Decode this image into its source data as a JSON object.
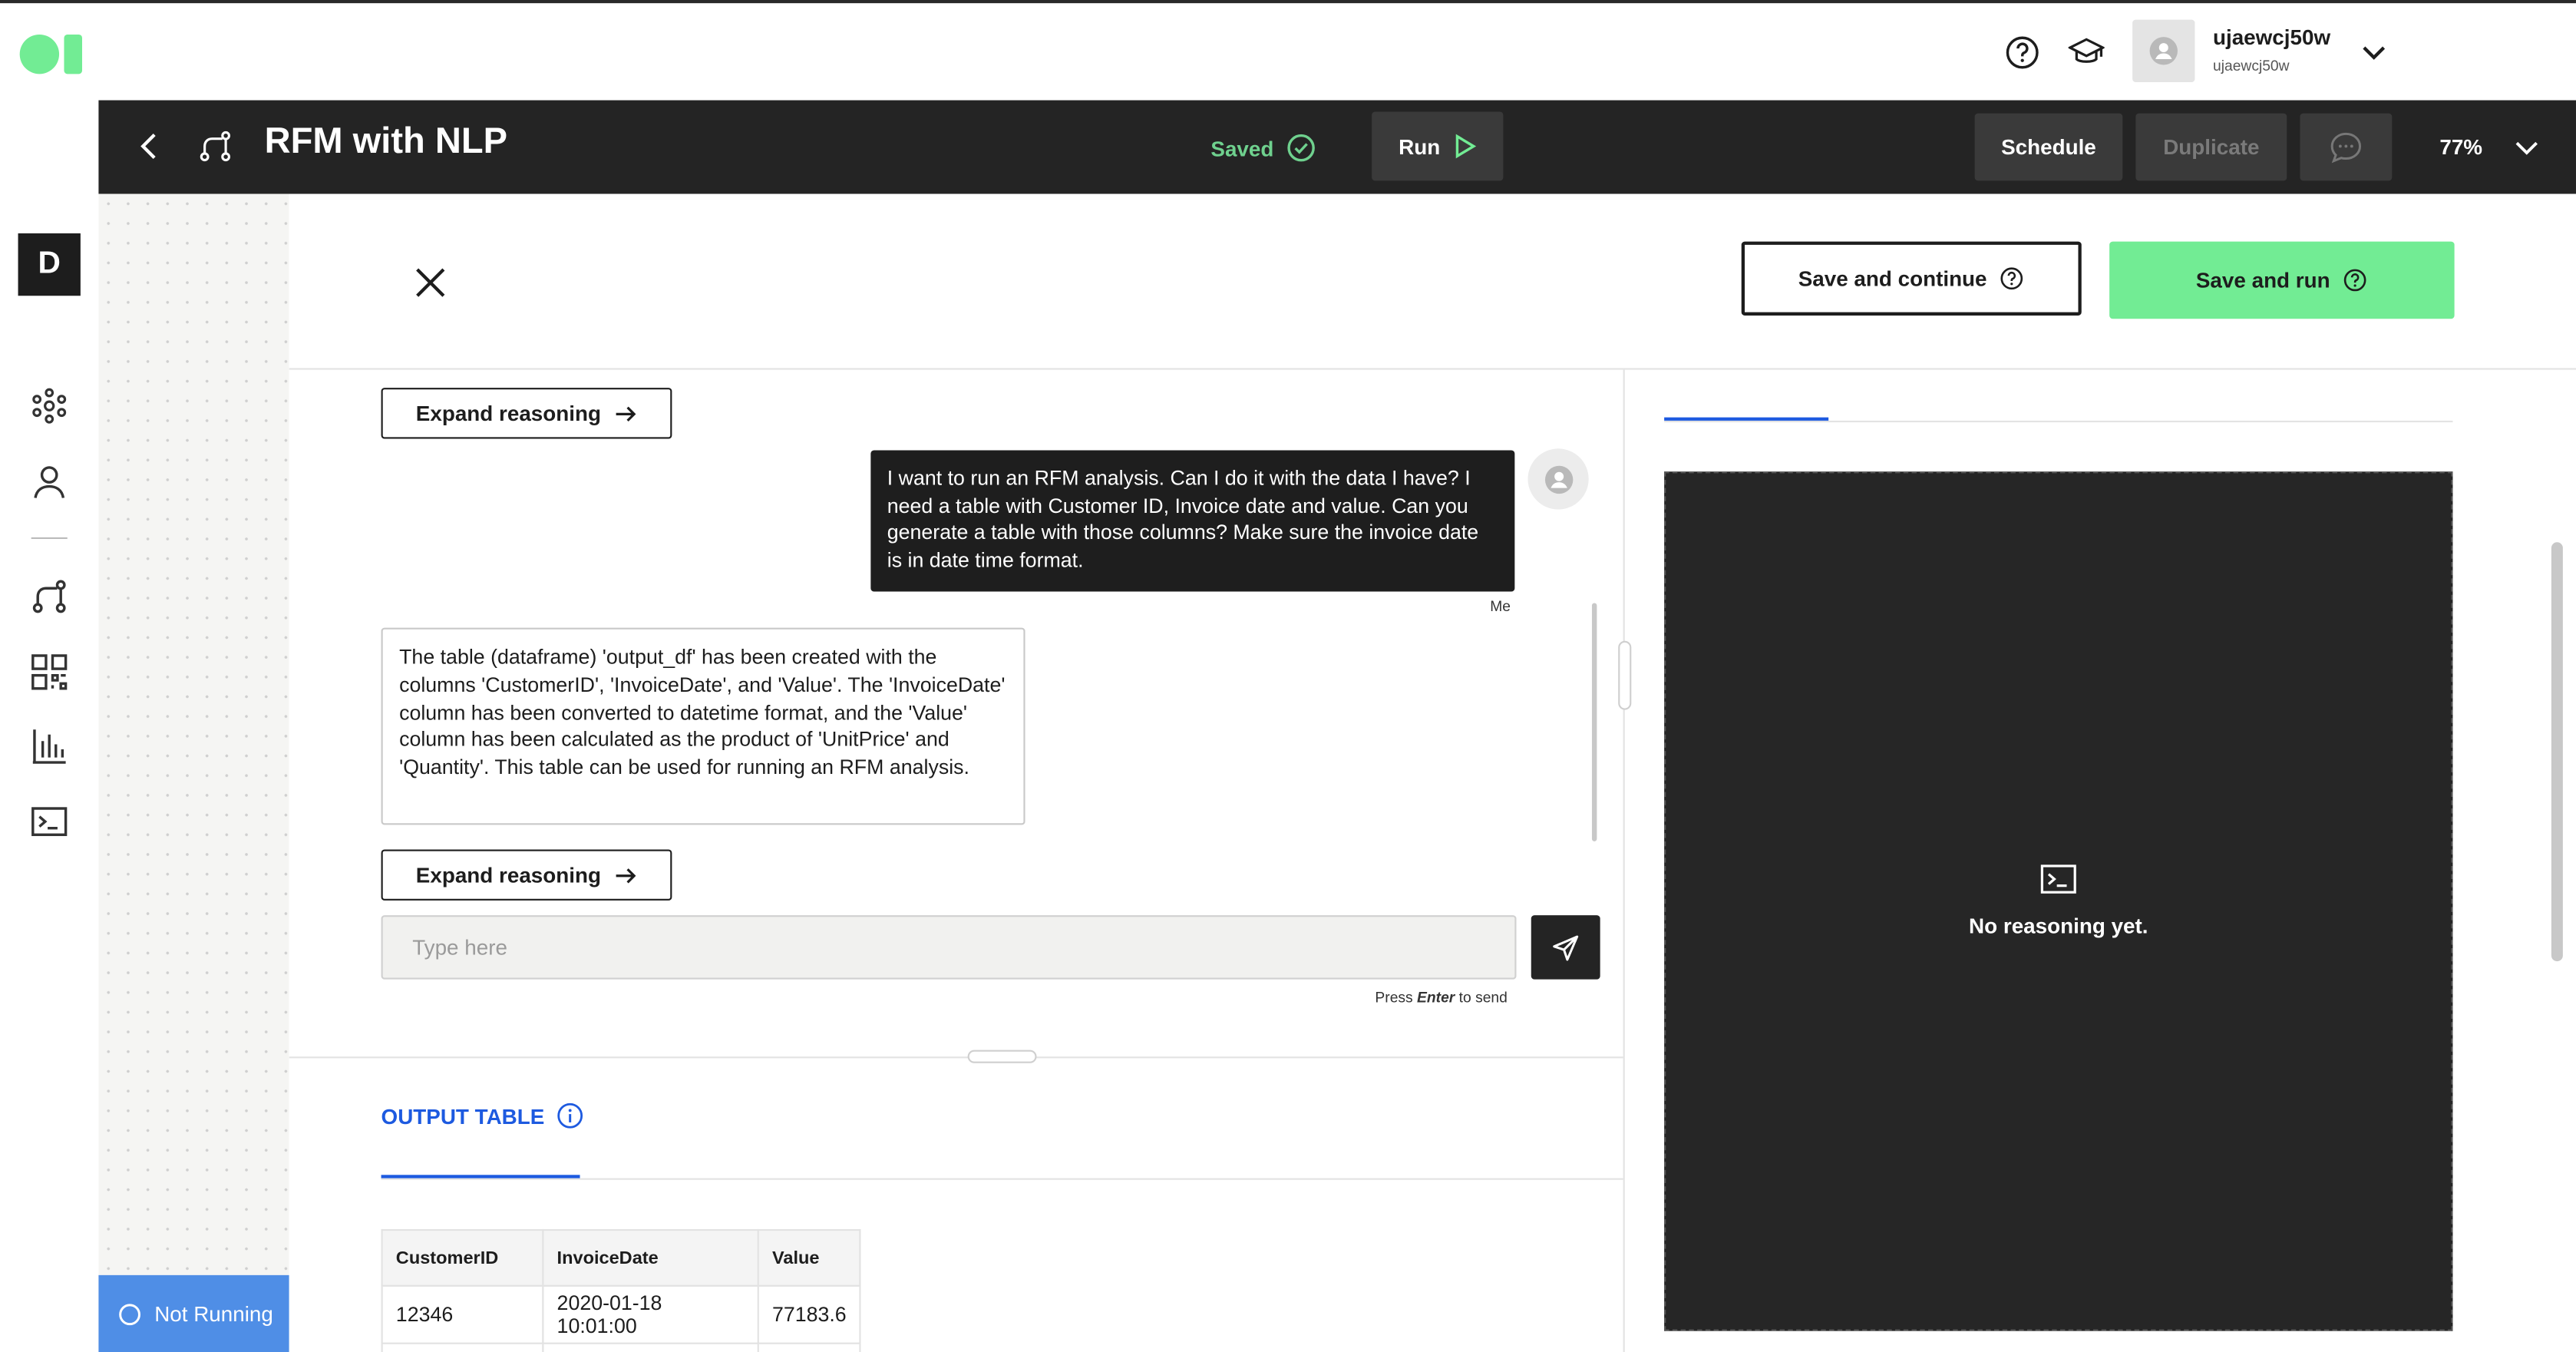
{
  "user": {
    "name": "ujaewcj50w",
    "sub": "ujaewcj50w"
  },
  "rail": {
    "letter": "D"
  },
  "header": {
    "title": "RFM with NLP",
    "saved": "Saved",
    "run": "Run",
    "schedule": "Schedule",
    "duplicate": "Duplicate",
    "zoom": "77%"
  },
  "status": {
    "not_running": "Not Running"
  },
  "modal": {
    "save_continue": "Save and continue",
    "save_run": "Save and run"
  },
  "chat": {
    "expand_reasoning": "Expand reasoning",
    "user_message": "I want to run an RFM analysis. Can I do it with the data I have? I need a table with Customer ID, Invoice date and value. Can you generate a table with those columns? Make sure the invoice date is in date time format.",
    "me_label": "Me",
    "ai_message": "The table (dataframe) 'output_df' has been created with the columns 'CustomerID', 'InvoiceDate', and 'Value'. The 'InvoiceDate' column has been converted to datetime format, and the 'Value' column has been calculated as the product of 'UnitPrice' and 'Quantity'. This table can be used for running an RFM analysis.",
    "input_placeholder": "Type here",
    "hint_prefix": "Press ",
    "hint_key": "Enter",
    "hint_suffix": " to send"
  },
  "output": {
    "tab_label": "OUTPUT TABLE",
    "columns": [
      "CustomerID",
      "InvoiceDate",
      "Value"
    ],
    "rows": [
      [
        "12346",
        "2020-01-18 10:01:00",
        "77183.6"
      ]
    ]
  },
  "reasoning": {
    "empty": "No reasoning yet."
  },
  "colors": {
    "accent_green": "#72ec94",
    "accent_blue": "#1d5ae0",
    "status_blue": "#4f8ee6",
    "dark": "#242424"
  },
  "icons": [
    "help-circle-icon",
    "graduation-cap-icon",
    "user-icon",
    "chevron-down-icon",
    "back-arrow-icon",
    "flow-icon",
    "check-circle-icon",
    "play-icon",
    "comment-icon",
    "close-icon",
    "arrow-right-icon",
    "send-icon",
    "info-icon",
    "terminal-icon"
  ]
}
